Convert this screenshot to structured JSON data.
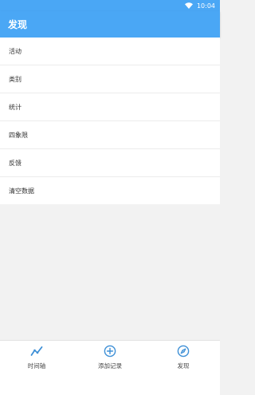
{
  "status_bar": {
    "time": "10:04"
  },
  "header": {
    "title": "发现"
  },
  "menu": {
    "items": [
      {
        "label": "活动"
      },
      {
        "label": "类别"
      },
      {
        "label": "统计"
      },
      {
        "label": "四象限"
      },
      {
        "label": "反馈"
      },
      {
        "label": "清空数据"
      }
    ]
  },
  "bottom_nav": {
    "items": [
      {
        "label": "时间轴",
        "icon": "trend-line-icon"
      },
      {
        "label": "添加记录",
        "icon": "plus-circle-icon"
      },
      {
        "label": "发现",
        "icon": "compass-icon"
      }
    ]
  },
  "colors": {
    "accent": "#4aa7f5",
    "icon": "#3d8fd6"
  }
}
